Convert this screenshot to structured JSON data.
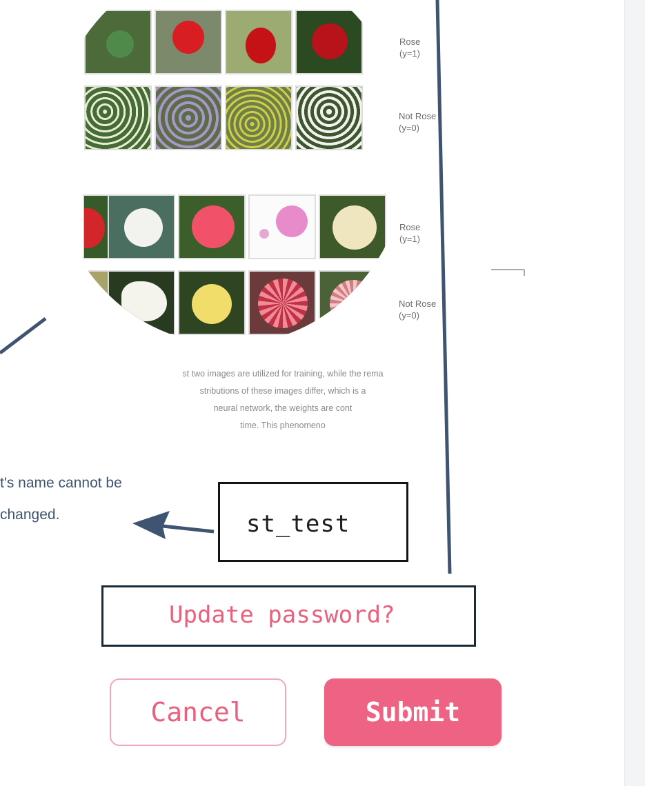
{
  "figure": {
    "rows": [
      {
        "label_line1": "Rose",
        "label_line2": "(y=1)"
      },
      {
        "label_line1": "Not Rose",
        "label_line2": "(y=0)"
      },
      {
        "label_line1": "Rose",
        "label_line2": "(y=1)"
      },
      {
        "label_line1": "Not Rose",
        "label_line2": "(y=0)"
      }
    ],
    "caption": [
      "st two images are utilized for training, while the rema",
      "stributions of these images differ, which is a",
      "neural network, the weights are cont",
      "time. This phenomeno"
    ]
  },
  "annotation": {
    "line1": "t's name cannot be",
    "line2": "changed."
  },
  "form": {
    "username_value": "st_test",
    "update_password_link": "Update password?",
    "cancel_label": "Cancel",
    "submit_label": "Submit"
  },
  "colors": {
    "accent": "#ee6383",
    "arrow": "#3f5470"
  }
}
